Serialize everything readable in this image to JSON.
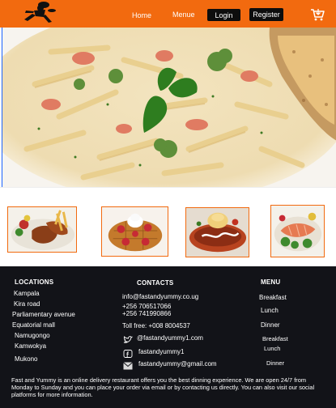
{
  "header": {
    "nav": {
      "home": "Home",
      "menu": "Menue"
    },
    "login": "Login",
    "register": "Register",
    "brand_color": "#f26a0f",
    "icons": {
      "logo": "running-chef-logo-icon",
      "cart": "shopping-cart-icon"
    }
  },
  "footer": {
    "locations": {
      "heading": "LOCATIONS",
      "items": [
        "Kampala",
        "Kira road",
        "Parliamentary avenue",
        "Equatorial mall",
        "Namugongo",
        "Kamwokya",
        "Mukono"
      ]
    },
    "contacts": {
      "heading": "CONTACTS",
      "email": "info@fastandyummy.co.ug",
      "phone1": "+256 706517066",
      "phone2": "+256 741990866",
      "tollfree": "Toll free: +008 8004537",
      "twitter": "@fastandyummy1.com",
      "facebook": "fastandyummy1",
      "gmail": "fastandyummy@gmail.com"
    },
    "menu": {
      "heading": "MENU",
      "items": [
        "Breakfast",
        "Lunch",
        "Dinner",
        "Breakfast",
        "Lunch",
        "Dinner"
      ]
    },
    "about": "Fast and Yummy is an online delivery restaurant offers you the best dinning experience. We are open 24/7 from Monday to Sunday and you can place your order via email or by contacting us directly. You can also visit our social platforms for more information."
  }
}
